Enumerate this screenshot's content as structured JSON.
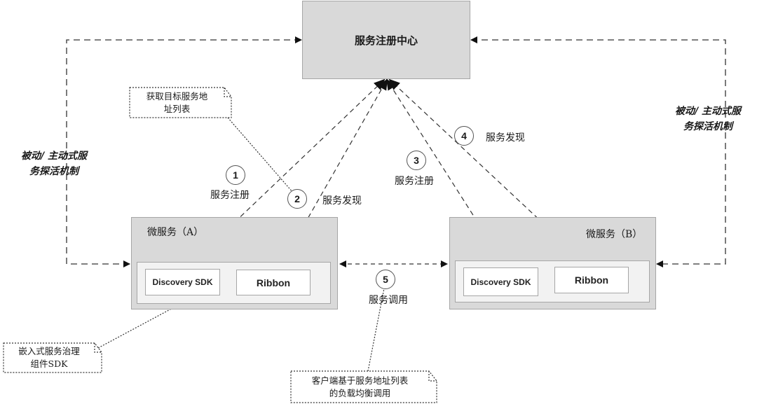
{
  "registry": {
    "label": "服务注册中心"
  },
  "service_a": {
    "title": "微服务（A）",
    "components": [
      "Discovery SDK",
      "Ribbon"
    ]
  },
  "service_b": {
    "title": "微服务（B）",
    "components": [
      "Discovery SDK",
      "Ribbon"
    ]
  },
  "steps": [
    {
      "number": "1",
      "label": "服务注册"
    },
    {
      "number": "2",
      "label": "服务发现"
    },
    {
      "number": "3",
      "label": "服务注册"
    },
    {
      "number": "4",
      "label": "服务发现"
    },
    {
      "number": "5",
      "label": "服务调用"
    }
  ],
  "health_check": {
    "left": [
      "被动/ 主动式服",
      "务探活机制"
    ],
    "right": [
      "被动/ 主动式服",
      "务探活机制"
    ]
  },
  "notes": {
    "get_list": [
      "获取目标服务地",
      "址列表"
    ],
    "embedded_sdk": [
      "嵌入式服务治理",
      "组件SDK"
    ],
    "client_lb": [
      "客户端基于服务地址列表",
      "的负载均衡调用"
    ]
  },
  "colors": {
    "box_fill": "#d9d9d9",
    "inner_fill": "#f2f2f2",
    "border": "#a6a6a6",
    "line": "#222222"
  }
}
